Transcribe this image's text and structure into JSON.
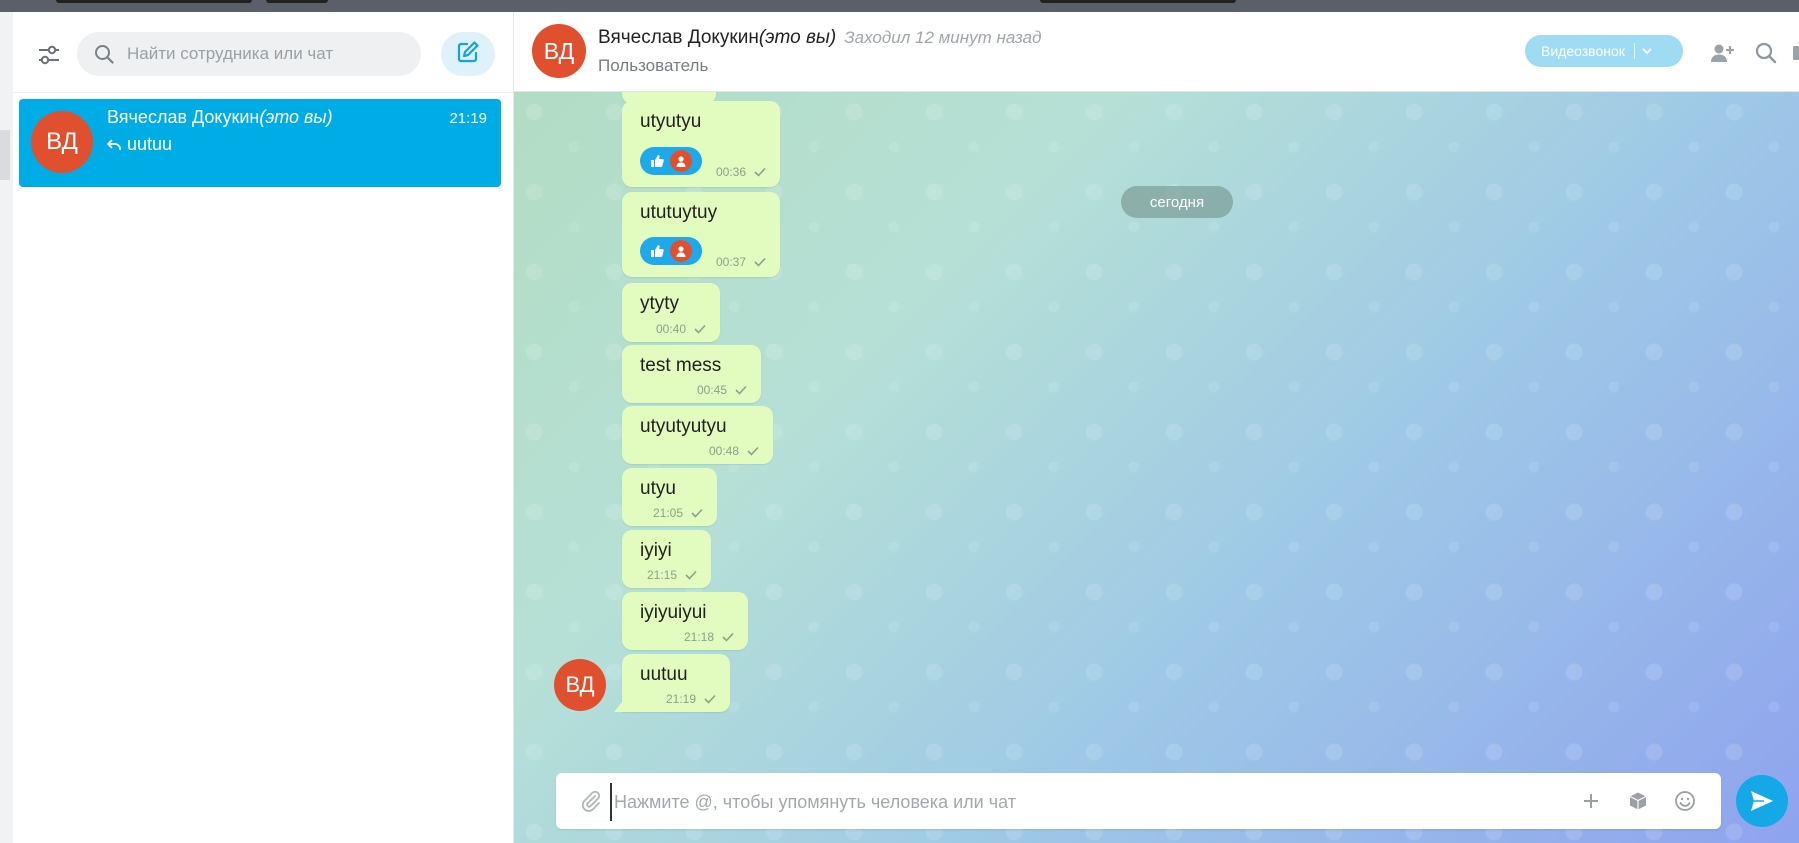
{
  "sidebar": {
    "search_placeholder": "Найти сотрудника или чат",
    "chat": {
      "avatar_initials": "ВД",
      "name": "Вячеслав Докукин",
      "name_suffix": "(это вы)",
      "time": "21:19",
      "last_message": "uutuu"
    }
  },
  "header": {
    "avatar_initials": "ВД",
    "name": "Вячеслав Докукин",
    "name_suffix": "(это вы)",
    "last_seen": "Заходил 12 минут назад",
    "role": "Пользователь",
    "video_call_label": "Видеозвонок"
  },
  "date_separator": "сегодня",
  "messages": [
    {
      "text": "utyutyu",
      "time": "00:36",
      "reactions": true
    },
    {
      "text": "ututuytuy",
      "time": "00:37",
      "reactions": true
    },
    {
      "text": "ytyty",
      "time": "00:40",
      "reactions": false
    },
    {
      "text": "test mess",
      "time": "00:45",
      "reactions": false
    },
    {
      "text": "utyutyutyu",
      "time": "00:48",
      "reactions": false
    },
    {
      "text": "utyu",
      "time": "21:05",
      "reactions": false
    },
    {
      "text": "iyiyi",
      "time": "21:15",
      "reactions": false
    },
    {
      "text": "iyiyuiyui",
      "time": "21:18",
      "reactions": false
    },
    {
      "text": "uutuu",
      "time": "21:19",
      "reactions": false
    }
  ],
  "sender_avatar_initials": "ВД",
  "composer": {
    "placeholder": "Нажмите @, чтобы упомянуть человека или чат"
  },
  "colors": {
    "accent": "#00ace6",
    "avatar": "#e0502e",
    "bubble": "#e2fbbf",
    "video_button": "#9fdcf4"
  }
}
